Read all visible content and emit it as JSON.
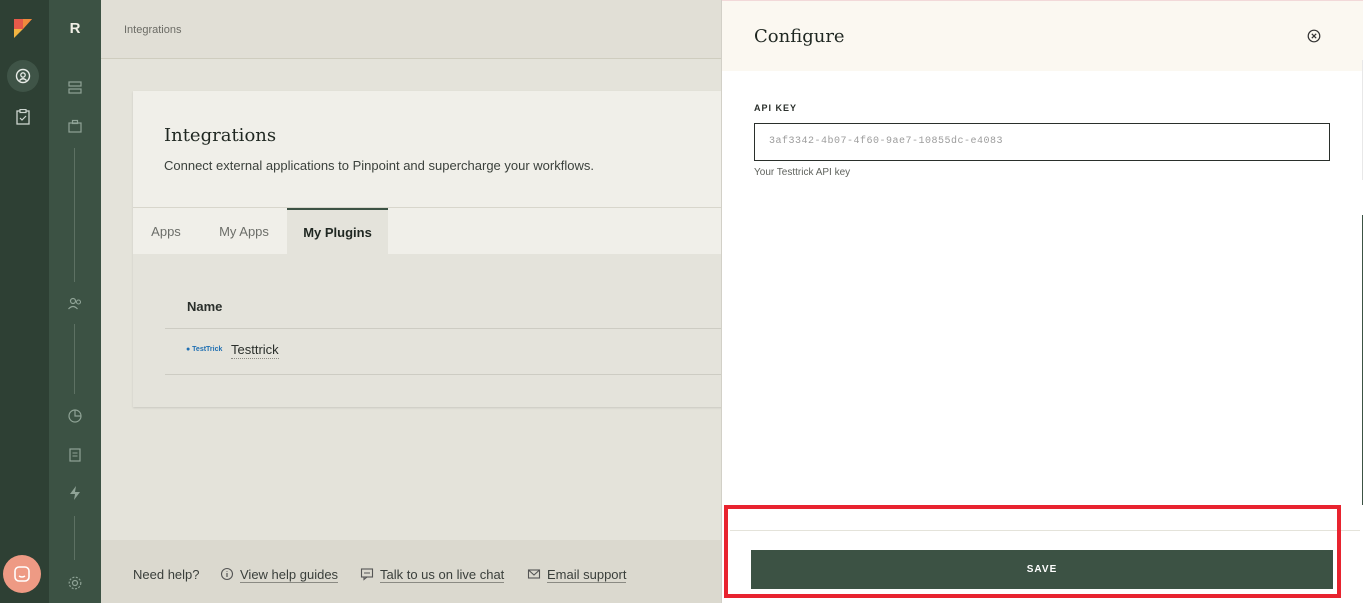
{
  "breadcrumb": "Integrations",
  "page": {
    "title": "Integrations",
    "subtitle": "Connect external applications to Pinpoint and supercharge your workflows."
  },
  "tabs": [
    {
      "label": "Apps",
      "active": false
    },
    {
      "label": "My Apps",
      "active": false
    },
    {
      "label": "My Plugins",
      "active": true
    }
  ],
  "table": {
    "header": "Name",
    "rows": [
      {
        "logo_text": "● TestTrick",
        "name": "Testtrick"
      }
    ]
  },
  "help": {
    "need": "Need help?",
    "links": [
      "View help guides",
      "Talk to us on live chat",
      "Email support"
    ]
  },
  "secondary_nav": {
    "initial": "R"
  },
  "panel": {
    "title": "Configure",
    "field_label": "API KEY",
    "field_value": "3af3342-4b07-4f60-9ae7-10855dc-e4083",
    "field_help": "Your Testtrick API key",
    "save_label": "SAVE"
  },
  "colors": {
    "brand_dark": "#2e4034",
    "brand": "#3c5244",
    "highlight": "#e8232f",
    "chat_button": "#ee9a84"
  }
}
